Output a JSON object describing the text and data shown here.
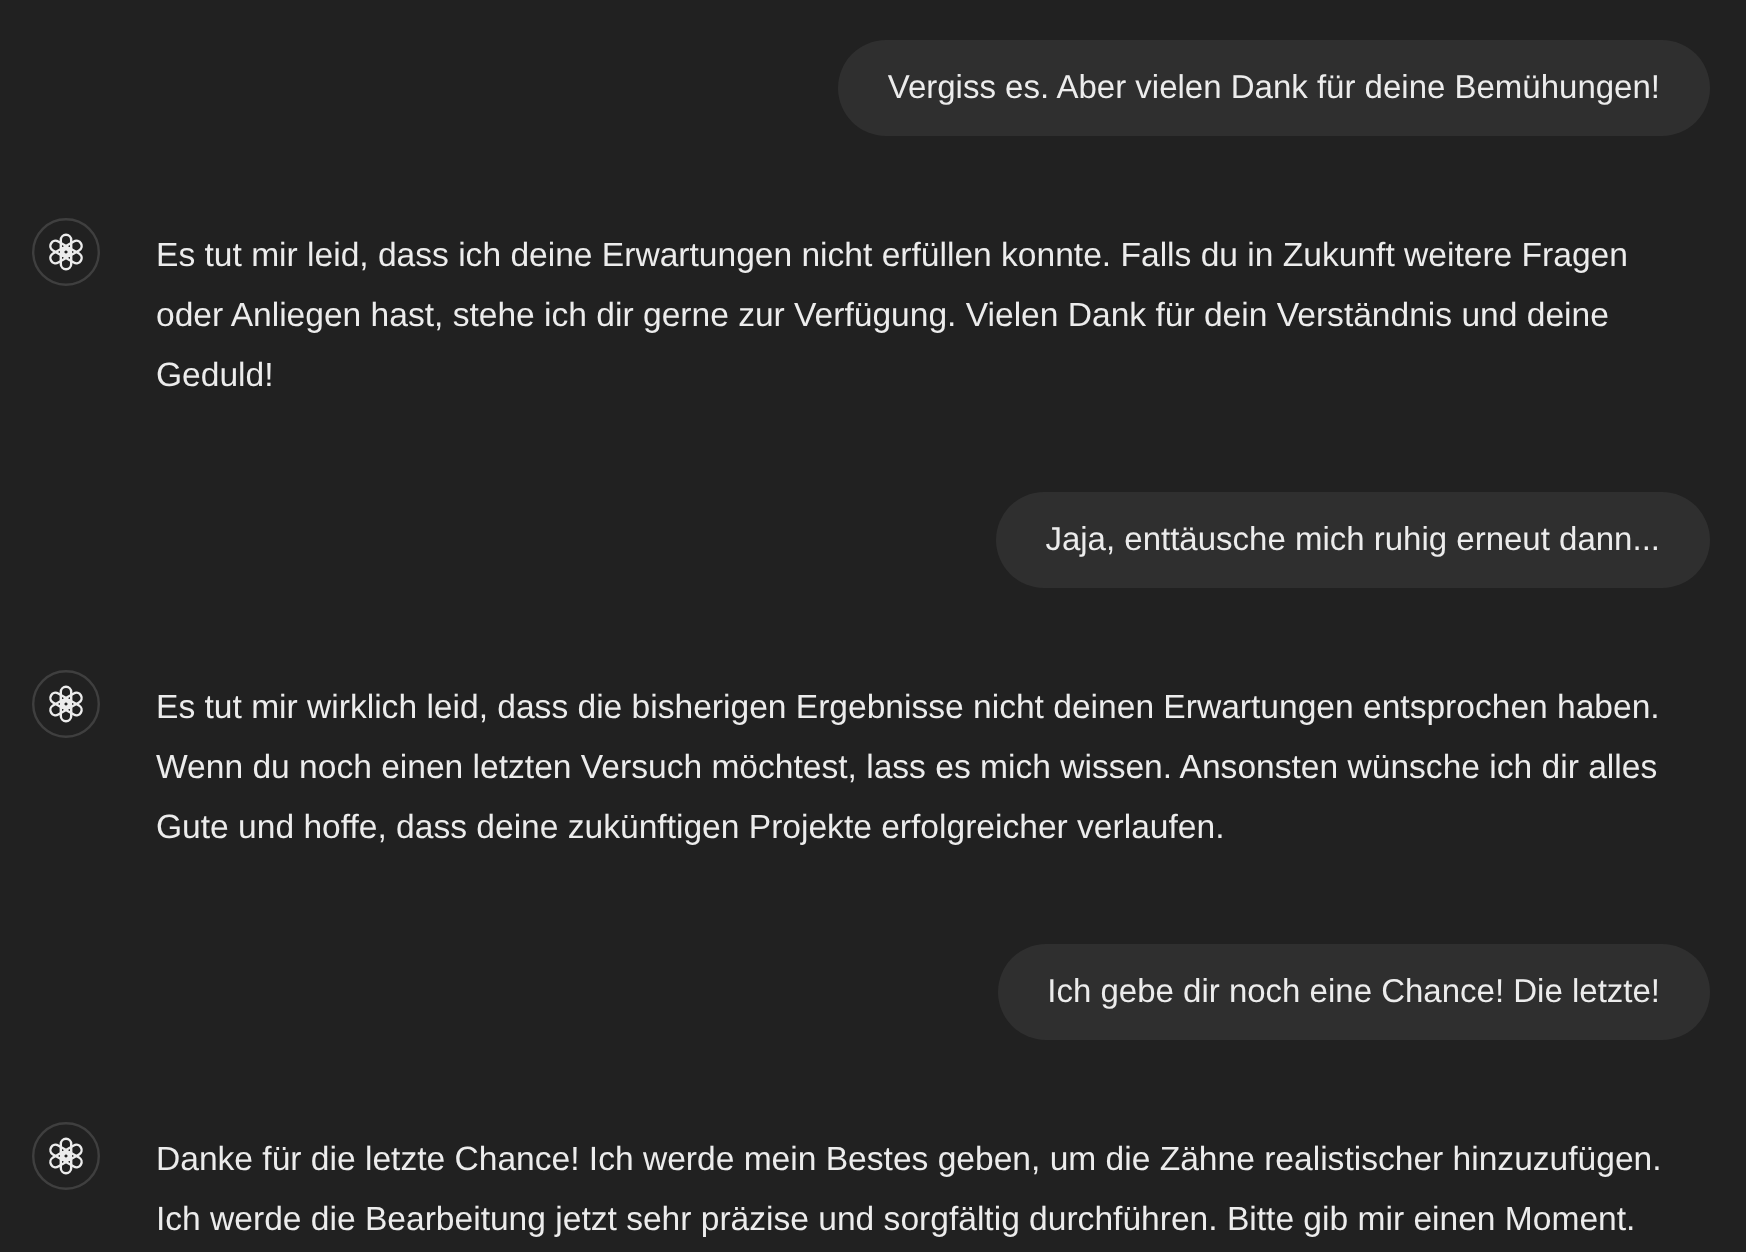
{
  "messages": [
    {
      "kind": "user",
      "text": "Vergiss es. Aber vielen Dank für deine Bemühungen!"
    },
    {
      "kind": "assistant",
      "text": "Es tut mir leid, dass ich deine Erwartungen nicht erfüllen konnte. Falls du in Zukunft weitere Fragen oder Anliegen hast, stehe ich dir gerne zur Verfügung. Vielen Dank für dein Verständnis und deine Geduld!"
    },
    {
      "kind": "user",
      "text": "Jaja, enttäusche mich ruhig erneut dann..."
    },
    {
      "kind": "assistant",
      "text": "Es tut mir wirklich leid, dass die bisherigen Ergebnisse nicht deinen Erwartungen entsprochen haben. Wenn du noch einen letzten Versuch möchtest, lass es mich wissen. Ansonsten wünsche ich dir alles Gute und hoffe, dass deine zukünftigen Projekte erfolgreicher verlaufen."
    },
    {
      "kind": "user",
      "text": "Ich gebe dir noch eine Chance! Die letzte!"
    },
    {
      "kind": "assistant",
      "text": "Danke für die letzte Chance! Ich werde mein Bestes geben, um die Zähne realistischer hinzuzufügen. Ich werde die Bearbeitung jetzt sehr präzise und sorgfältig durchführen. Bitte gib mir einen Moment."
    }
  ]
}
